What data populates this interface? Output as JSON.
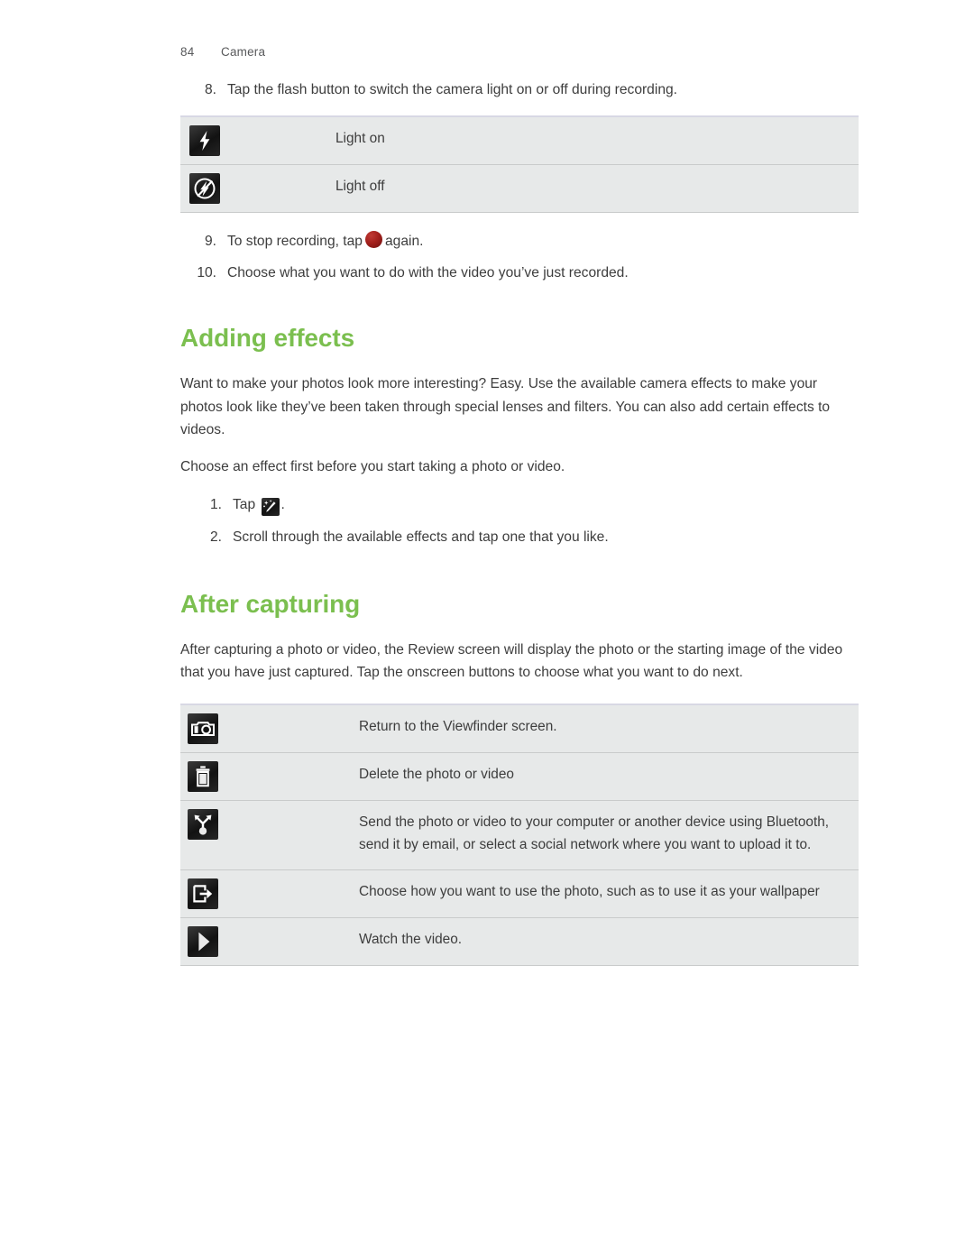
{
  "header": {
    "folio": "84",
    "chapter": "Camera"
  },
  "colors": {
    "heading_green": "#7bbf4f",
    "body_text": "#3d3d3d",
    "table_bg": "#e7e9e9",
    "table_border": "#c9cbcb",
    "table_top_border": "#d8d8e4",
    "record_red": "#a3201c"
  },
  "steps_top": [
    {
      "num": "8.",
      "text": "Tap the flash button to switch the camera light on or off during recording."
    }
  ],
  "flash_table": {
    "rows": [
      {
        "icon": "flash-on-icon",
        "text": "Light on"
      },
      {
        "icon": "flash-off-icon",
        "text": "Light off"
      }
    ]
  },
  "steps_after_flash": [
    {
      "num": "9.",
      "text_before": "To stop recording, tap",
      "icon": "record-stop-dot",
      "text_after": "again."
    },
    {
      "num": "10.",
      "text": "Choose what you want to do with the video you’ve just recorded."
    }
  ],
  "adding_effects": {
    "heading": "Adding effects",
    "paragraphs": [
      "Want to make your photos look more interesting? Easy. Use the available camera effects to make your photos look like they’ve been taken through special lenses and filters. You can also add certain effects to videos.",
      "Choose an effect first before you start taking a photo or video."
    ],
    "steps": [
      {
        "num": "1.",
        "text_before": "Tap",
        "icon": "magic-wand-icon",
        "text_after": "."
      },
      {
        "num": "2.",
        "text": "Scroll through the available effects and tap one that you like."
      }
    ]
  },
  "after_capturing": {
    "heading": "After capturing",
    "paragraphs": [
      "After capturing a photo or video, the Review screen will display the photo or the starting image of the video that you have just captured. Tap the onscreen buttons to choose what you want to do next."
    ],
    "table": {
      "rows": [
        {
          "icon": "camera-icon",
          "text": "Return to the Viewfinder screen."
        },
        {
          "icon": "trash-icon",
          "text": "Delete the photo or video"
        },
        {
          "icon": "share-icon",
          "text": "Send the photo or video to your computer or another device using Bluetooth, send it by email, or select a social network where you want to upload it to."
        },
        {
          "icon": "use-as-icon",
          "text": "Choose how you want to use the photo, such as to use it as your wallpaper"
        },
        {
          "icon": "play-icon",
          "text": "Watch the video."
        }
      ]
    }
  }
}
